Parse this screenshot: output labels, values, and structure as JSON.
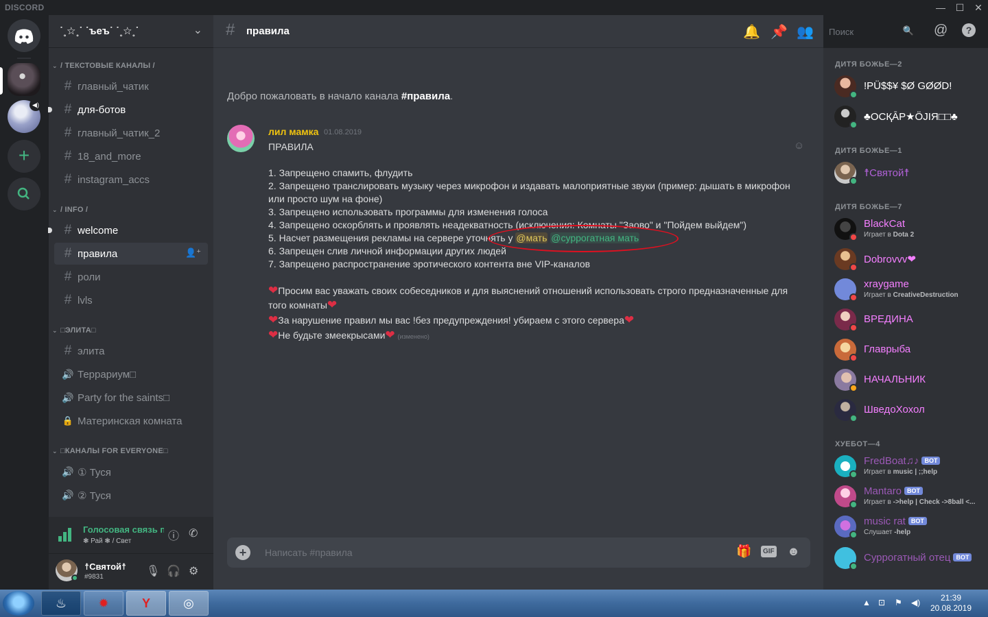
{
  "titlebar": {
    "brand": "DISCORD",
    "minimize": "—",
    "maximize": "☐",
    "close": "✕"
  },
  "server": {
    "name": "˙˳☆˳˙ ˙ъеъ˙ ˙˳☆˳˙"
  },
  "categories": [
    {
      "label": "/ ТЕКСТОВЫЕ КАНАЛЫ /"
    },
    {
      "label": "/ INFO /"
    },
    {
      "label": "□ЭЛИТА□"
    },
    {
      "label": "□КАНАЛЫ FOR EVERYONE□"
    }
  ],
  "channels": [
    {
      "label": "главный_чатик",
      "icon": "#"
    },
    {
      "label": "для-ботов",
      "icon": "#"
    },
    {
      "label": "главный_чатик_2",
      "icon": "#"
    },
    {
      "label": "18_and_more",
      "icon": "#"
    },
    {
      "label": "instagram_accs",
      "icon": "#"
    },
    {
      "label": "welcome",
      "icon": "#"
    },
    {
      "label": "правила",
      "icon": "#"
    },
    {
      "label": "роли",
      "icon": "#"
    },
    {
      "label": "lvls",
      "icon": "#"
    },
    {
      "label": "элита",
      "icon": "#"
    },
    {
      "label": "Террариум□",
      "icon": "🔊"
    },
    {
      "label": "Party for the saints□",
      "icon": "🔊"
    },
    {
      "label": "Материнская комната",
      "icon": "🔒"
    },
    {
      "label": "① Туся",
      "icon": "🔊"
    },
    {
      "label": "② Туся",
      "icon": "🔊"
    }
  ],
  "voice": {
    "status": "Голосовая связь подключена",
    "sub": "❃ Рай ❃ / Свет"
  },
  "user": {
    "name": "☨Святой☨",
    "tag": "#9831"
  },
  "chat": {
    "channel": "правила",
    "search_placeholder": "Поиск",
    "welcome_prefix": "Добро пожаловать в начало канала ",
    "welcome_channel": "#правила",
    "welcome_suffix": ".",
    "composer_placeholder": "Написать #правила",
    "gif_label": "GIF"
  },
  "message": {
    "author": "лил мамка",
    "date": "01.08.2019",
    "title": "ПРАВИЛА",
    "rules": [
      "1. Запрещено спамить, флудить",
      "2. Запрещено транслировать музыку через микрофон и издавать малоприятные звуки (пример: дышать в микрофон",
      "или просто шум на фоне)",
      "3. Запрещено использовать программы для изменения голоса",
      "4. Запрещено оскорблять и проявлять неадекватность (исключения: Комнаты \"Заово\" и \"Пойдем выйдем\")",
      "5. Насчет размещения рекламы на сервере уточнять у ",
      "6. Запрещен слив личной информации других людей",
      "7. Запрещено распространение эротического контента вне VIP-каналов"
    ],
    "mention1": "@мать",
    "mention2": "@суррогатная мать",
    "heart": "❤",
    "line_a": "Просим вас уважать своих собеседников и для выяснений отношений использовать строго предназначенные для",
    "line_b": "того комнаты",
    "line_c": "За нарушение правил мы вас !без предупреждения! убираем с этого сервера",
    "line_d": "Не будьте змеекрысами",
    "edited": "(изменено)"
  },
  "member_groups": [
    {
      "label": "ДИТЯ БОЖЬЕ—2"
    },
    {
      "label": "ДИТЯ БОЖЬЕ—1"
    },
    {
      "label": "ДИТЯ БОЖЬЕ—7"
    },
    {
      "label": "ХУЕБОТ—4"
    }
  ],
  "members": [
    {
      "name": "!PÜ$$¥ $Ø GØØD!",
      "color": "#ffffff",
      "status": "online"
    },
    {
      "name": "♣ОСҚĀР★ӦJIЯ□□♣",
      "color": "#ffffff",
      "status": "online"
    },
    {
      "name": "☨Святой☨",
      "color": "#b061d6",
      "status": "online"
    },
    {
      "name": "BlackCat",
      "color": "#f47fff",
      "game_prefix": "Играет в ",
      "game": "Dota 2",
      "status": "dnd"
    },
    {
      "name": "Dobrovvv❤",
      "color": "#f47fff",
      "status": "dnd"
    },
    {
      "name": "xraygame",
      "color": "#f47fff",
      "game_prefix": "Играет в ",
      "game": "CreativeDestruction",
      "status": "dnd"
    },
    {
      "name": "ВРЕДИНА",
      "color": "#f47fff",
      "status": "dnd"
    },
    {
      "name": "Главрыба",
      "color": "#f47fff",
      "status": "dnd"
    },
    {
      "name": "НАЧАЛЬНИК",
      "color": "#f47fff",
      "status": "idle"
    },
    {
      "name": "ШведоХохол",
      "color": "#f47fff",
      "status": "online"
    },
    {
      "name": "FredBoat♫♪",
      "color": "#9b59b6",
      "bot": "BOT",
      "game_prefix": "Играет в ",
      "game": "music | ;;help",
      "status": "online"
    },
    {
      "name": "Mantaro",
      "color": "#9b59b6",
      "bot": "BOT",
      "game_prefix": "Играет в ",
      "game": "->help | Check ->8ball <...",
      "status": "online"
    },
    {
      "name": "music rat",
      "color": "#9b59b6",
      "bot": "BOT",
      "game_prefix": "Слушает ",
      "game": "-help",
      "status": "online"
    },
    {
      "name": "Суррогатный отец",
      "color": "#9b59b6",
      "bot": "BOT",
      "status": "online"
    }
  ],
  "taskbar": {
    "time": "21:39",
    "date": "20.08.2019"
  },
  "colors": {
    "accent": "#7289da",
    "online": "#43b581",
    "dnd": "#f04747",
    "idle": "#faa61a",
    "mention": "#faa61a"
  },
  "icons": {
    "home": "discord-logo-icon",
    "add": "plus-icon",
    "explore": "search-icon",
    "bell": "bell-icon",
    "pin": "pin-icon",
    "members": "members-icon",
    "mention": "at-icon",
    "help": "help-icon",
    "gift": "gift-icon",
    "emoji": "emoji-icon",
    "mic": "mic-icon",
    "headphones": "headphones-icon",
    "settings": "gear-icon"
  }
}
